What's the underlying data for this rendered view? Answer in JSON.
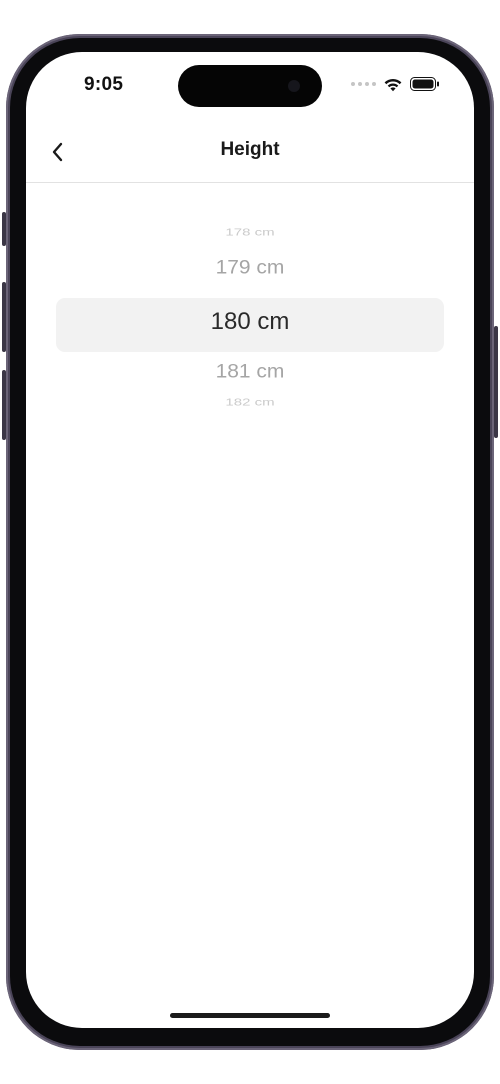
{
  "status_bar": {
    "time": "9:05",
    "icons": [
      "cellular-dots-icon",
      "wifi-icon",
      "battery-icon"
    ]
  },
  "nav": {
    "back_icon": "chevron-left-icon",
    "title": "Height"
  },
  "picker": {
    "options": [
      "178 cm",
      "179 cm",
      "180 cm",
      "181 cm",
      "182 cm"
    ],
    "selected": "180 cm"
  },
  "colors": {
    "highlight": "#f2f2f2",
    "text_selected": "#2a2a2a",
    "text_unselected": "#a8a8a8"
  }
}
